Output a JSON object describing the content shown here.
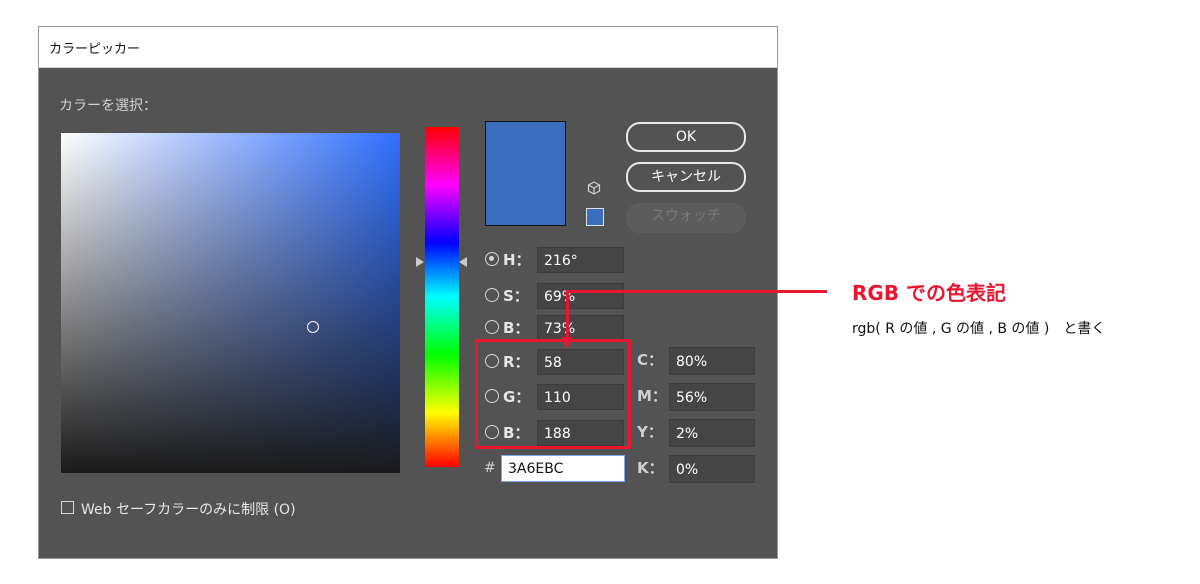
{
  "dialog": {
    "title": "カラーピッカー",
    "section_label": "カラーを選択：",
    "selected_color": "#3A6EBC",
    "buttons": {
      "ok": "OK",
      "cancel": "キャンセル",
      "swatches": "スウォッチ"
    },
    "icons": {
      "cube": "cube-icon"
    },
    "hsb": [
      {
        "label": "H：",
        "value": "216°",
        "checked": true
      },
      {
        "label": "S：",
        "value": "69%",
        "checked": false
      },
      {
        "label": "B：",
        "value": "73%",
        "checked": false
      }
    ],
    "rgb": [
      {
        "label": "R：",
        "value": "58"
      },
      {
        "label": "G：",
        "value": "110"
      },
      {
        "label": "B：",
        "value": "188"
      }
    ],
    "cmyk": [
      {
        "label": "C：",
        "value": "80%"
      },
      {
        "label": "M：",
        "value": "56%"
      },
      {
        "label": "Y：",
        "value": "2%"
      },
      {
        "label": "K：",
        "value": "0%"
      }
    ],
    "hex_prefix": "#",
    "hex_value": "3A6EBC",
    "web_safe_only": {
      "label": "Web セーフカラーのみに制限 (O)",
      "checked": false
    }
  },
  "annotation": {
    "title": "RGB での色表記",
    "subtitle": "rgb( R の値 , G の値 , B の値 )　と書く",
    "color": "#e8162f"
  }
}
